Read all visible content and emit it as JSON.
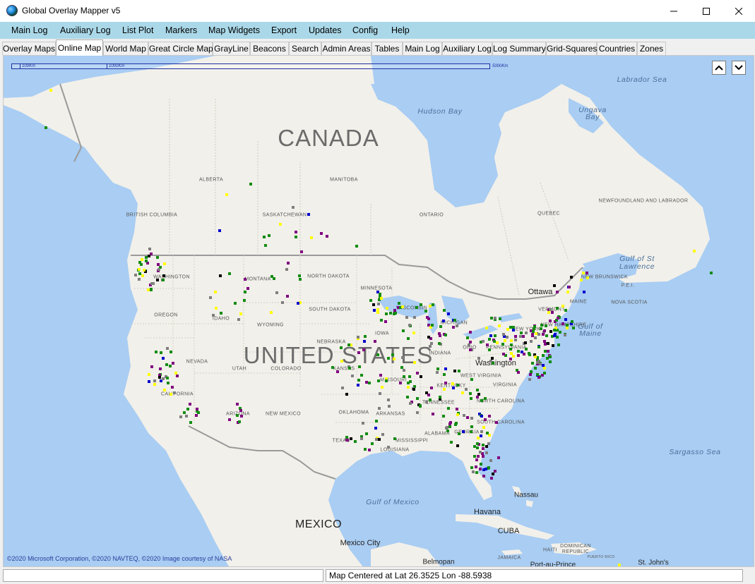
{
  "window": {
    "title": "Global Overlay Mapper v5",
    "app_icon": "globe-icon"
  },
  "menu": [
    "Main Log",
    "Auxiliary Log",
    "List Plot",
    "Markers",
    "Map Widgets",
    "Export",
    "Updates",
    "Config",
    "Help"
  ],
  "tabs": [
    "Overlay Maps",
    "Online Map",
    "World Map",
    "Great Circle Map",
    "GrayLine",
    "Beacons",
    "Search",
    "Admin Areas",
    "Tables",
    "Main Log",
    "Auxiliary Log",
    "Log Summary",
    "Grid-Squares",
    "Countries",
    "Zones"
  ],
  "active_tab": "Online Map",
  "map": {
    "scale_labels": [
      "100Km",
      "1000Km",
      "5000Km"
    ],
    "countries": [
      "CANADA",
      "UNITED STATES",
      "MEXICO"
    ],
    "states": [
      "ALBERTA",
      "MANITOBA",
      "BRITISH COLUMBIA",
      "SASKATCHEWAN",
      "ONTARIO",
      "QUEBEC",
      "NEWFOUNDLAND AND LABRADOR",
      "NORTH DAKOTA",
      "WASHINGTON",
      "MONTANA",
      "MINNESOTA",
      "NEW BRUNSWICK",
      "P.E.I.",
      "MAINE",
      "SOUTH DAKOTA",
      "WISCONSIN",
      "OREGON",
      "IDAHO",
      "VERMONT",
      "NOVA SCOTIA",
      "WYOMING",
      "MICHIGAN",
      "NEW YORK",
      "NEW HAMPSHIRE",
      "NEBRASKA",
      "IOWA",
      "NEVADA",
      "UTAH",
      "COLORADO",
      "KANSAS",
      "INDIANA",
      "OHIO",
      "PENNSYLVANIA",
      "MISSOURI",
      "WEST VIRGINIA",
      "VIRGINIA",
      "CALIFORNIA",
      "KENTUCKY",
      "TENNESSEE",
      "NORTH CAROLINA",
      "OKLAHOMA",
      "ARIZONA",
      "NEW MEXICO",
      "ARKANSAS",
      "SOUTH CAROLINA",
      "ALABAMA",
      "GEORGIA",
      "MISSISSIPPI",
      "TEXAS",
      "LOUISIANA"
    ],
    "waters": [
      "Labrador Sea",
      "Hudson Bay",
      "Ungava Bay",
      "Gulf of St Lawrence",
      "Gulf of Maine",
      "Sargasso Sea",
      "Gulf of Mexico"
    ],
    "cities": [
      "Ottawa",
      "Washington",
      "Nassau",
      "Havana",
      "CUBA",
      "Mexico City",
      "HAITI",
      "DOMINICAN REPUBLIC",
      "JAMAICA",
      "Port-au-Prince",
      "Belmopan",
      "St. John's",
      "PUERTO RICO"
    ],
    "copyright": "©2020 Microsoft Corporation, ©2020 NAVTEQ, ©2020 Image courtesy of NASA",
    "marker_colors": [
      "#138c13",
      "#800080",
      "#7f7f7f",
      "#ffff00",
      "#0000cc",
      "#000000"
    ]
  },
  "status": {
    "text": "Map Centered at Lat 26.3525  Lon -88.5938"
  }
}
